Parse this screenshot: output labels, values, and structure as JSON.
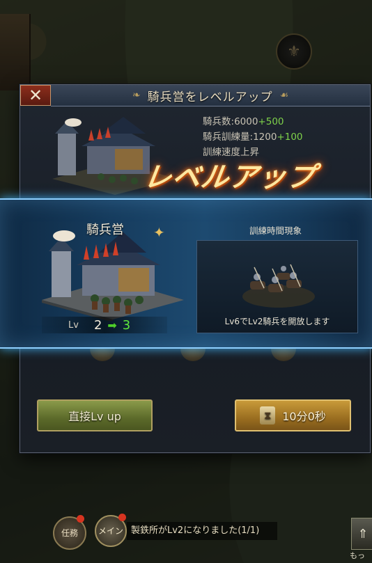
{
  "dialog": {
    "title": "騎兵営をレベルアップ",
    "close_icon": "close-icon",
    "stats": [
      {
        "label": "騎兵数:",
        "value": "6000",
        "increase": "+500"
      },
      {
        "label": "騎兵訓練量:",
        "value": "1200",
        "increase": "+100"
      },
      {
        "label": "訓練速度上昇",
        "value": "",
        "increase": ""
      }
    ],
    "levelup_text": "レベルアップ"
  },
  "banner": {
    "building_name": "騎兵営",
    "level_label": "Lv",
    "level_current": "2",
    "level_next": "3",
    "reward_title": "訓練時間現象",
    "reward_caption": "Lv6でLv2騎兵を開放します"
  },
  "buttons": {
    "direct_label": "直接Lv up",
    "time_label": "10分0秒",
    "hourglass_icon": "hourglass-icon"
  },
  "bottom_bar": {
    "task_label": "任務",
    "main_label": "メイン",
    "notice_text": "製鉄所がLv2になりました(1/1)",
    "more_label": "もっ"
  },
  "colors": {
    "increase": "#7fd24a",
    "level_next": "#5fe83a",
    "banner_glow": "#8fd0ff",
    "direct_button": "#6c7a32",
    "time_button": "#a87a28"
  }
}
